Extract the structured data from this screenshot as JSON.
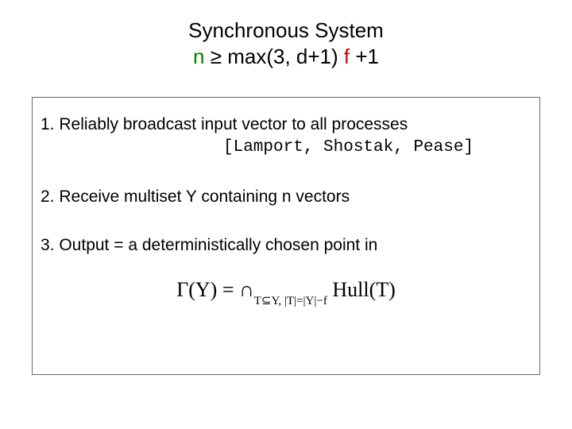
{
  "title": {
    "line1": "Synchronous System",
    "n": "n",
    "mid": "  ≥ max(3, d+1) ",
    "f": "f",
    "tail": " +1"
  },
  "steps": {
    "s1": "1. Reliably broadcast input vector to all processes",
    "s1_cite": "[Lamport, Shostak, Pease]",
    "s2": "2. Receive multiset Y containing n vectors",
    "s3": "3. Output = a deterministically chosen point in"
  },
  "formula": {
    "lhs": "Γ(Y) = ∩",
    "sub": "T⊆Y, |T|=|Y|−f",
    "rhs": " Hull(T)"
  }
}
